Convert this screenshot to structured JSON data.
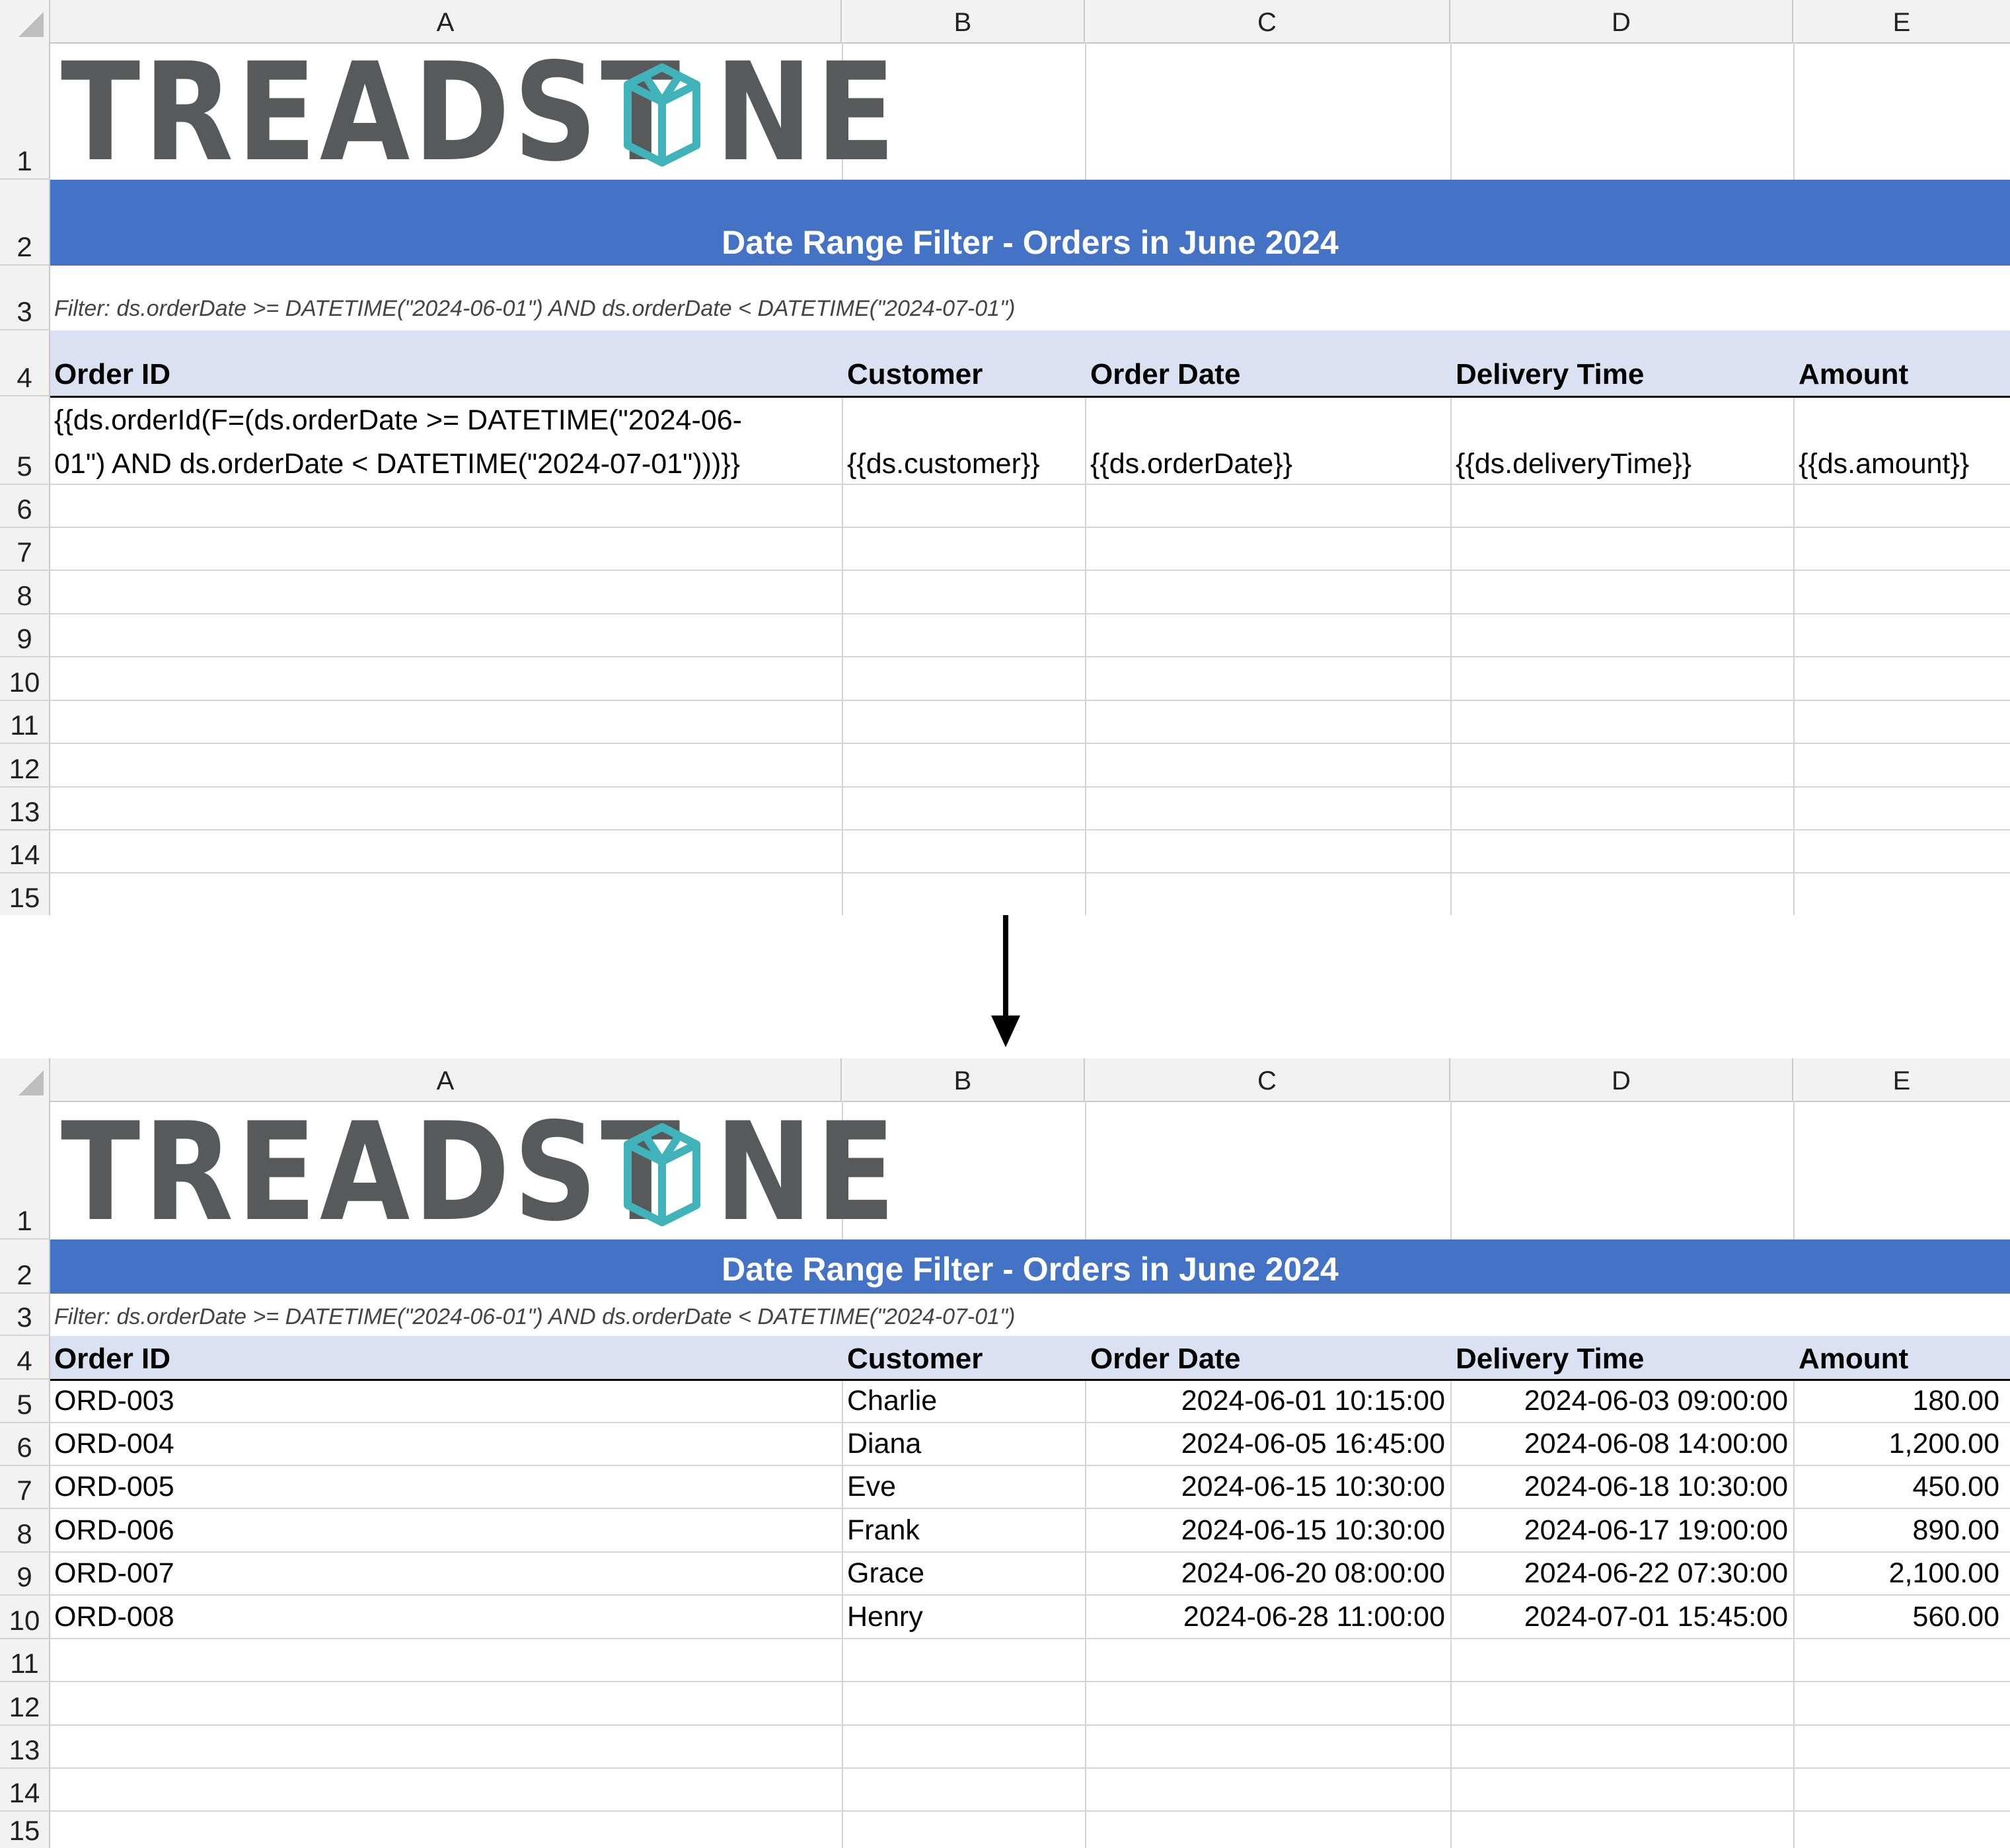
{
  "columns": [
    "A",
    "B",
    "C",
    "D",
    "E"
  ],
  "row_numbers": [
    "1",
    "2",
    "3",
    "4",
    "5",
    "6",
    "7",
    "8",
    "9",
    "10",
    "11",
    "12",
    "13",
    "14",
    "15"
  ],
  "logo": {
    "text_left": "TREADST",
    "text_right": "NE",
    "text_color": "#58595b",
    "mark_color": "#3fb3b9",
    "mark_icon": "gem-cube-icon"
  },
  "title": "Date Range Filter - Orders in June 2024",
  "filter_note": "Filter: ds.orderDate >= DATETIME(\"2024-06-01\") AND ds.orderDate < DATETIME(\"2024-07-01\")",
  "headers": [
    "Order ID",
    "Customer",
    "Order Date",
    "Delivery Time",
    "Amount"
  ],
  "template_row": {
    "order_id_line1": "{{ds.orderId(F=(ds.orderDate >= DATETIME(\"2024-06-",
    "order_id_line2": "01\") AND ds.orderDate < DATETIME(\"2024-07-01\")))}}",
    "customer": "{{ds.customer}}",
    "order_date": "{{ds.orderDate}}",
    "delivery_time": "{{ds.deliveryTime}}",
    "amount": "{{ds.amount}}"
  },
  "result_rows": [
    {
      "order_id": "ORD-003",
      "customer": "Charlie",
      "order_date": "2024-06-01 10:15:00",
      "delivery_time": "2024-06-03 09:00:00",
      "amount": "180.00"
    },
    {
      "order_id": "ORD-004",
      "customer": "Diana",
      "order_date": "2024-06-05 16:45:00",
      "delivery_time": "2024-06-08 14:00:00",
      "amount": "1,200.00"
    },
    {
      "order_id": "ORD-005",
      "customer": "Eve",
      "order_date": "2024-06-15 10:30:00",
      "delivery_time": "2024-06-18 10:30:00",
      "amount": "450.00"
    },
    {
      "order_id": "ORD-006",
      "customer": "Frank",
      "order_date": "2024-06-15 10:30:00",
      "delivery_time": "2024-06-17 19:00:00",
      "amount": "890.00"
    },
    {
      "order_id": "ORD-007",
      "customer": "Grace",
      "order_date": "2024-06-20 08:00:00",
      "delivery_time": "2024-06-22 07:30:00",
      "amount": "2,100.00"
    },
    {
      "order_id": "ORD-008",
      "customer": "Henry",
      "order_date": "2024-06-28 11:00:00",
      "delivery_time": "2024-07-01 15:45:00",
      "amount": "560.00"
    }
  ],
  "colors": {
    "title_band": "#4472c4",
    "header_band": "#d9e1f2",
    "grid_line": "#d4d4d4",
    "header_strip": "#f2f2f2"
  }
}
